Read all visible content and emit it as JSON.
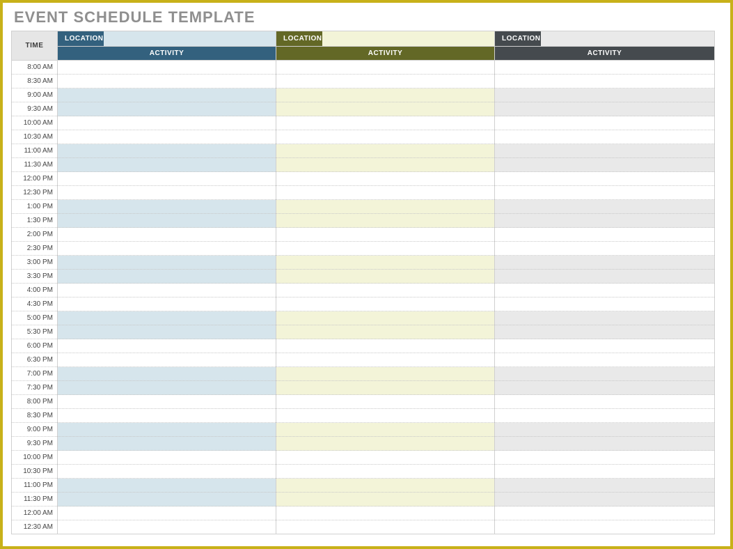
{
  "title": "EVENT SCHEDULE TEMPLATE",
  "headers": {
    "time": "TIME",
    "location": "LOCATION",
    "activity": "ACTIVITY"
  },
  "columns": [
    {
      "location_value": "",
      "activity_value": ""
    },
    {
      "location_value": "",
      "activity_value": ""
    },
    {
      "location_value": "",
      "activity_value": ""
    }
  ],
  "times": [
    "8:00 AM",
    "8:30 AM",
    "9:00 AM",
    "9:30 AM",
    "10:00 AM",
    "10:30 AM",
    "11:00 AM",
    "11:30 AM",
    "12:00 PM",
    "12:30 PM",
    "1:00 PM",
    "1:30 PM",
    "2:00 PM",
    "2:30 PM",
    "3:00 PM",
    "3:30 PM",
    "4:00 PM",
    "4:30 PM",
    "5:00 PM",
    "5:30 PM",
    "6:00 PM",
    "6:30 PM",
    "7:00 PM",
    "7:30 PM",
    "8:00 PM",
    "8:30 PM",
    "9:00 PM",
    "9:30 PM",
    "10:00 PM",
    "10:30 PM",
    "11:00 PM",
    "11:30 PM",
    "12:00 AM",
    "12:30 AM"
  ],
  "shade_pattern_start": "light"
}
